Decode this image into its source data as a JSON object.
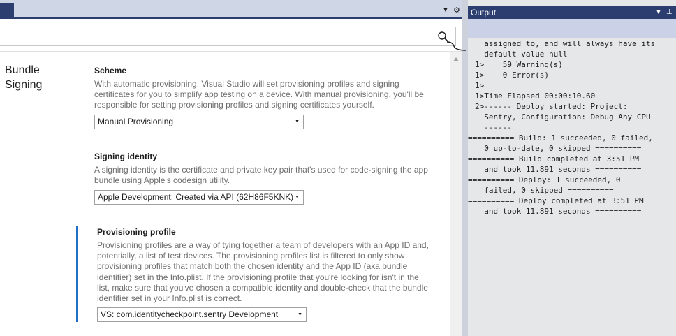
{
  "left_pane": {
    "search": {
      "placeholder": ""
    }
  },
  "section": {
    "title": "Bundle Signing"
  },
  "scheme": {
    "heading": "Scheme",
    "description": "With automatic provisioning, Visual Studio will set provisioning profiles and signing certificates for you to simplify app testing on a device. With manual provisioning, you'll be responsible for setting provisioning profiles and signing certificates yourself.",
    "selected": "Manual Provisioning"
  },
  "signing_identity": {
    "heading": "Signing identity",
    "description": "A signing identity is the certificate and private key pair that's used for code-signing the app bundle using Apple's codesign utility.",
    "selected": "Apple Development: Created via API (62H86F5KNK)"
  },
  "provisioning_profile": {
    "heading": "Provisioning profile",
    "description": "Provisioning profiles are a way of tying together a team of developers with an App ID and, potentially, a list of test devices. The provisioning profiles list is filtered to only show provisioning profiles that match both the chosen identity and the App ID (aka bundle identifier) set in the Info.plist. If the provisioning profile that you're looking for isn't in the list, make sure that you've chosen a compatible identity and double-check that the bundle identifier set in your Info.plist is correct.",
    "selected": "VS: com.identitycheckpoint.sentry Development"
  },
  "output": {
    "title": "Output",
    "lines": [
      "  assigned to, and will always have its",
      "  default value null",
      "1>    59 Warning(s)",
      "1>    0 Error(s)",
      "1>",
      "1>Time Elapsed 00:00:10.60",
      "2>------ Deploy started: Project:",
      "  Sentry, Configuration: Debug Any CPU",
      "  ------",
      "========== Build: 1 succeeded, 0 failed,",
      "  0 up-to-date, 0 skipped ==========",
      "========== Build completed at 3:51 PM",
      "  and took 11.891 seconds ==========",
      "========== Deploy: 1 succeeded, 0",
      "  failed, 0 skipped ==========",
      "========== Deploy completed at 3:51 PM",
      "  and took 11.891 seconds =========="
    ]
  },
  "icons": {
    "search": "search-icon",
    "dropdown": "chevron-down-icon",
    "pin": "pin-icon",
    "settings": "gear-icon"
  },
  "colors": {
    "accent": "#1e6fc6",
    "tool_window_header": "#2c3e6f",
    "output_bg": "#e6e7e8"
  }
}
